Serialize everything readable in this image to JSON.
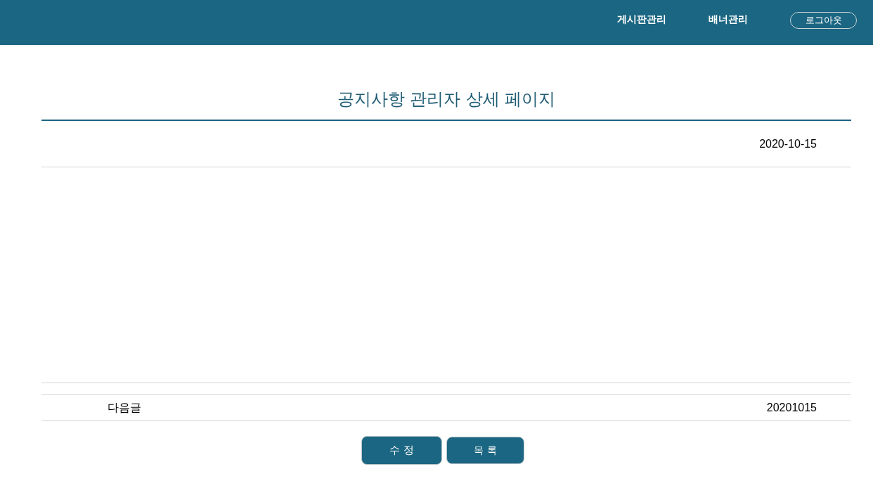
{
  "header": {
    "nav": [
      "게시판관리",
      "배너관리"
    ],
    "logout_button": "로그아웃"
  },
  "page_title": "공지사항 관리자 상세 페이지",
  "post": {
    "date": "2020-10-15"
  },
  "next_post": {
    "label": "다음글",
    "date": "20201015"
  },
  "buttons": [
    "수 정",
    "목 록"
  ]
}
